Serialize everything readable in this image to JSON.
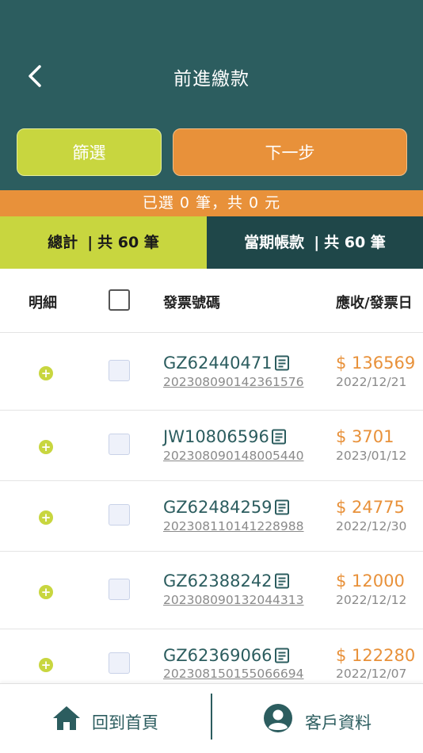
{
  "header": {
    "title": "前進繳款"
  },
  "actions": {
    "filter_label": "篩選",
    "next_label": "下一步"
  },
  "summary": {
    "text": "已選 0 筆，共 0 元"
  },
  "tabs": {
    "total": {
      "label": "總計",
      "sep": "|",
      "count": "共 60 筆"
    },
    "period": {
      "label": "當期帳款",
      "sep": "|",
      "count": "共 60 筆"
    }
  },
  "table": {
    "headers": {
      "detail": "明細",
      "invoice": "發票號碼",
      "amount": "應收/發票日"
    },
    "rows": [
      {
        "invoice": "GZ62440471",
        "txn": "20230809014236157​6",
        "amount": "$ 136569",
        "date": "2022/12/21"
      },
      {
        "invoice": "JW10806596",
        "txn": "20230809014800544​0",
        "amount": "$ 3701",
        "date": "2023/01/12"
      },
      {
        "invoice": "GZ62484259",
        "txn": "20230811014122898​8",
        "amount": "$ 24775",
        "date": "2022/12/30"
      },
      {
        "invoice": "GZ62388242",
        "txn": "20230809013204431​3",
        "amount": "$ 12000",
        "date": "2022/12/12"
      },
      {
        "invoice": "GZ62369066",
        "txn": "20230815015506669​4",
        "amount": "$ 122280",
        "date": "2022/12/07"
      }
    ]
  },
  "footer": {
    "home_label": "回到首頁",
    "client_label": "客戶資料"
  },
  "colors": {
    "primary": "#2c5d5f",
    "accent": "#e8913a",
    "lime": "#c8d63f",
    "dark_tab": "#1f4749"
  }
}
